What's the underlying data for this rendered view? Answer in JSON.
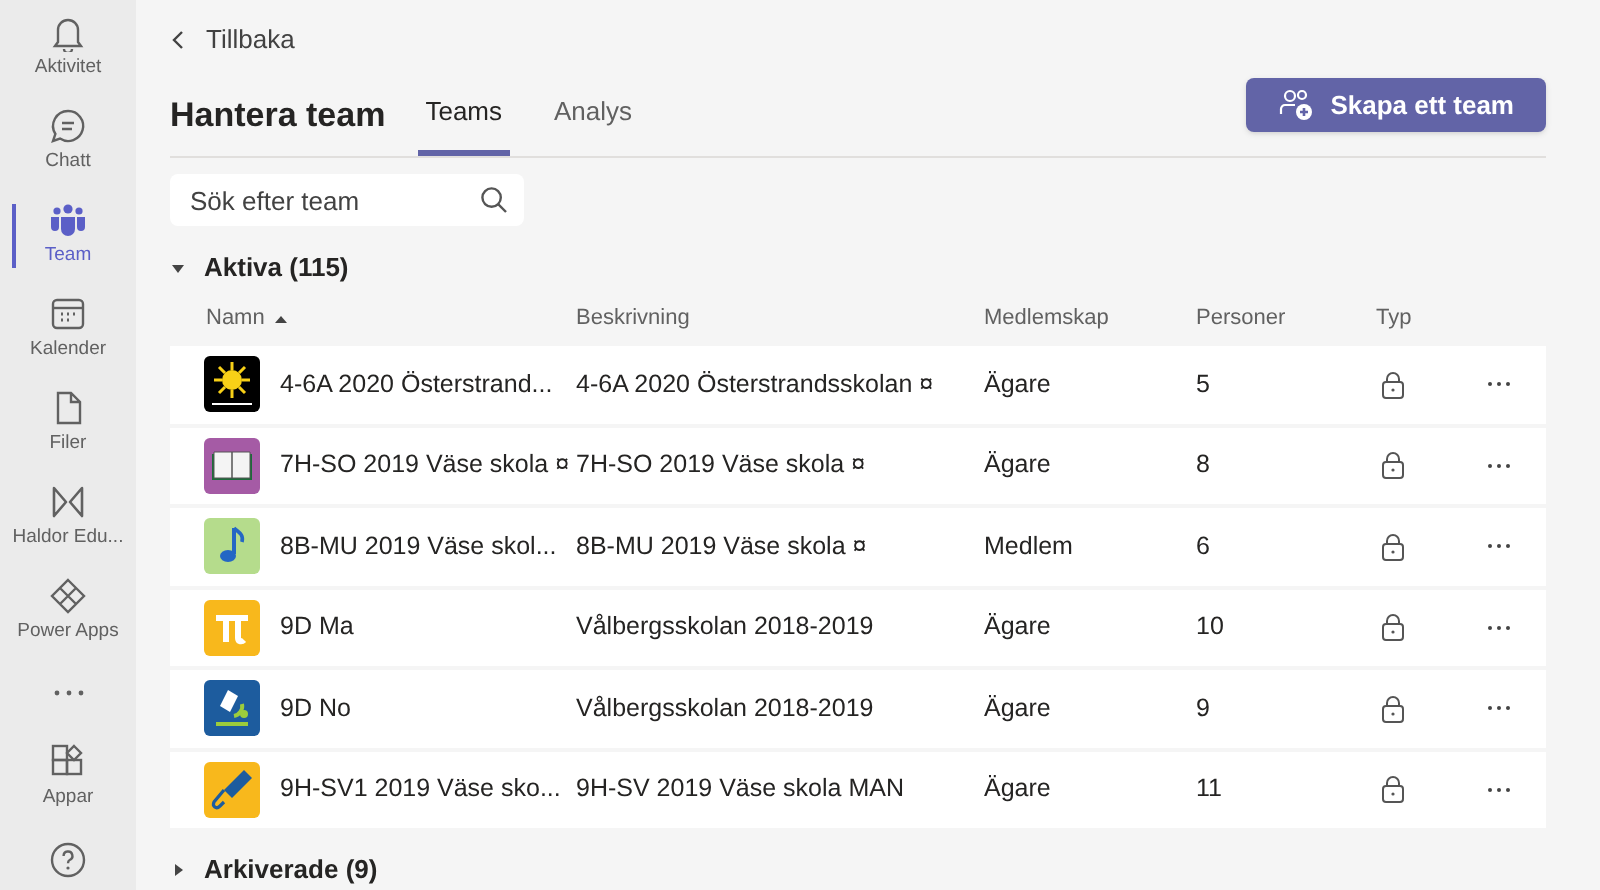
{
  "sidebar": {
    "items": [
      {
        "kind": "bell",
        "label": "Aktivitet",
        "selected": false
      },
      {
        "kind": "chat",
        "label": "Chatt",
        "selected": false
      },
      {
        "kind": "teams",
        "label": "Team",
        "selected": true
      },
      {
        "kind": "calendar",
        "label": "Kalender",
        "selected": false
      },
      {
        "kind": "file",
        "label": "Filer",
        "selected": false
      },
      {
        "kind": "haldor",
        "label": "Haldor Edu...",
        "selected": false
      },
      {
        "kind": "powerapps",
        "label": "Power Apps",
        "selected": false
      },
      {
        "kind": "more"
      },
      {
        "kind": "apps",
        "label": "Appar",
        "selected": false
      },
      {
        "kind": "help"
      }
    ]
  },
  "back_link": "Tillbaka",
  "page_title": "Hantera team",
  "tabs": [
    {
      "label": "Teams",
      "selected": true
    },
    {
      "label": "Analys",
      "selected": false
    }
  ],
  "create_button": "Skapa ett team",
  "search": {
    "placeholder": "Sök efter team"
  },
  "sections": [
    {
      "title": "Aktiva (115)",
      "expanded": true,
      "columns": [
        "Namn",
        "Beskrivning",
        "Medlemskap",
        "Personer",
        "Typ"
      ],
      "rows": [
        {
          "kind": "sun",
          "color": "#000000",
          "name": "4-6A 2020 Österstrand...",
          "description": "4-6A 2020 Österstrandsskolan ¤",
          "membership": "Ägare",
          "people": "5",
          "private": true
        },
        {
          "kind": "book",
          "color": "#a55ba5",
          "name": "7H-SO 2019 Väse skola ¤",
          "description": "7H-SO 2019 Väse skola ¤",
          "membership": "Ägare",
          "people": "8",
          "private": true
        },
        {
          "kind": "note",
          "color": "#b5dc8c",
          "name": "8B-MU 2019 Väse skol...",
          "description": "8B-MU 2019 Väse skola ¤",
          "membership": "Medlem",
          "people": "6",
          "private": true
        },
        {
          "kind": "pi",
          "color": "#f8b81c",
          "name": "9D Ma",
          "description": "Vålbergsskolan 2018-2019",
          "membership": "Ägare",
          "people": "10",
          "private": true
        },
        {
          "kind": "microscope",
          "color": "#1d5c9e",
          "name": "9D No",
          "description": "Vålbergsskolan 2018-2019",
          "membership": "Ägare",
          "people": "9",
          "private": true
        },
        {
          "kind": "microphone",
          "color": "#f8b81c",
          "name": "9H-SV1  2019 Väse sko...",
          "description": "9H-SV  2019 Väse skola MAN",
          "membership": "Ägare",
          "people": "11",
          "private": true
        }
      ]
    },
    {
      "title": "Arkiverade (9)",
      "expanded": false
    }
  ]
}
